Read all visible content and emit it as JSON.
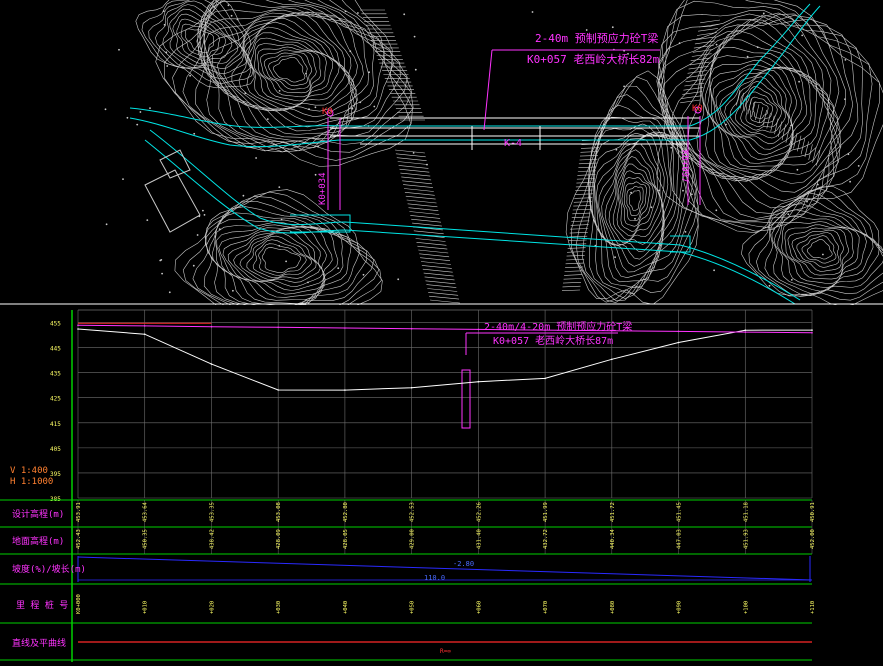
{
  "plan": {
    "bridge_label_line1": "2-40m 预制预应力砼T梁",
    "bridge_label_line2": "K0+057 老西岭大桥长82m",
    "marker_left": "K0",
    "marker_right": "K0",
    "center_label": "K-4",
    "side_label_left": "K0+034",
    "side_label_right": "K0+097"
  },
  "profile": {
    "label_line1": "2-40m/4-20m 预制预应力砼T梁",
    "label_line2": "K0+057 老西岭大桥长87m",
    "scale_v": "V 1:400",
    "scale_h": "H 1:1000",
    "y_ticks": [
      "455",
      "445",
      "435",
      "425",
      "415",
      "405",
      "395",
      "385"
    ],
    "row_labels": {
      "design": "设计高程(m)",
      "ground": "地面高程(m)",
      "slope": "坡度(%)/坡长(m)",
      "station": "里 程 桩 号",
      "curve": "直线及平曲线"
    },
    "design_values": [
      "453.91",
      "453.64",
      "453.35",
      "453.08",
      "452.80",
      "452.53",
      "452.26",
      "451.99",
      "451.72",
      "451.45",
      "451.18",
      "450.91"
    ],
    "ground_values": [
      "452.43",
      "450.35",
      "438.42",
      "428.09",
      "428.05",
      "429.00",
      "431.40",
      "432.72",
      "440.34",
      "447.03",
      "451.93",
      "452.00"
    ],
    "station_values": [
      "K0+000",
      "+010",
      "+020",
      "+030",
      "+040",
      "+050",
      "+060",
      "+070",
      "+080",
      "+090",
      "+100",
      "+110"
    ],
    "slope_text": "-2.80",
    "slope_length": "110.0",
    "curve_text": "R=∞"
  },
  "colors": {
    "contour": "#c9c9c9",
    "road": "#00e5e5",
    "annotation": "#ff33ff",
    "grid_green": "#00d000",
    "axis_gray": "#6f6f6f",
    "design_red": "#ff2a2a",
    "ground": "#ffffff",
    "tick_yellow": "#ffff66",
    "slope_blue": "#2a2aff",
    "scale_orange": "#ff8030"
  },
  "chart_data": {
    "type": "line",
    "title": "",
    "xlabel": "",
    "ylabel": "",
    "x": [
      0,
      10,
      20,
      30,
      40,
      50,
      60,
      70,
      80,
      90,
      100,
      110
    ],
    "ylim": [
      385,
      460
    ],
    "series": [
      {
        "name": "设计高程(m)",
        "values": [
          453.91,
          453.64,
          453.35,
          453.08,
          452.8,
          452.53,
          452.26,
          451.99,
          451.72,
          451.45,
          451.18,
          450.91
        ]
      },
      {
        "name": "地面高程(m)",
        "values": [
          452.43,
          450.35,
          438.42,
          428.09,
          428.05,
          429.0,
          431.4,
          432.72,
          440.34,
          447.03,
          451.93,
          452.0
        ]
      }
    ]
  }
}
